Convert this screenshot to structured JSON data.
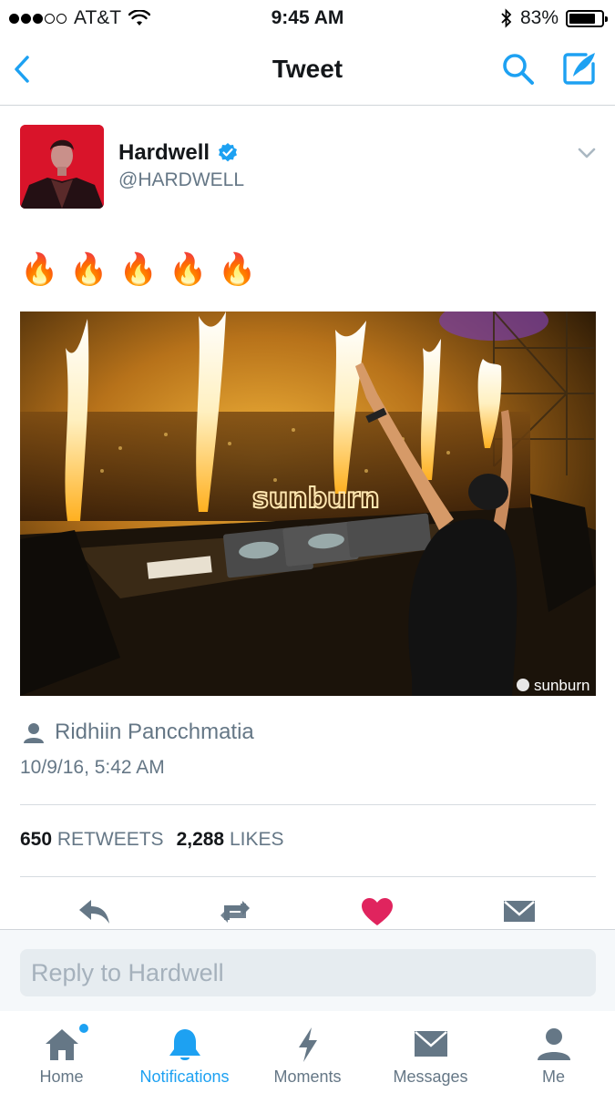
{
  "status_bar": {
    "carrier": "AT&T",
    "time": "9:45 AM",
    "battery": "83%",
    "battery_level": 0.83,
    "signal_bars": 3,
    "signal_total": 5
  },
  "nav": {
    "title": "Tweet",
    "back_icon": "chevron-left-icon",
    "search_icon": "search-icon",
    "compose_icon": "compose-icon"
  },
  "tweet": {
    "author_name": "Hardwell",
    "author_handle": "@HARDWELL",
    "verified": true,
    "text": "🔥🔥🔥🔥🔥",
    "photo_tag": "Ridhiin Pancchmatia",
    "timestamp": "10/9/16, 5:42 AM",
    "media_watermark": "sunburn",
    "media_banner": "sunburn",
    "stats": {
      "retweets_count": "650",
      "retweets_label": "RETWEETS",
      "likes_count": "2,288",
      "likes_label": "LIKES"
    },
    "actions": [
      "reply-icon",
      "retweet-icon",
      "like-icon",
      "direct-message-icon"
    ]
  },
  "reply": {
    "placeholder": "Reply to Hardwell"
  },
  "tabs": [
    {
      "label": "Home",
      "icon": "home-icon",
      "active": false,
      "badge": true
    },
    {
      "label": "Notifications",
      "icon": "bell-icon",
      "active": true,
      "badge": false
    },
    {
      "label": "Moments",
      "icon": "lightning-icon",
      "active": false,
      "badge": false
    },
    {
      "label": "Messages",
      "icon": "envelope-icon",
      "active": false,
      "badge": false
    },
    {
      "label": "Me",
      "icon": "person-icon",
      "active": false,
      "badge": false
    }
  ],
  "colors": {
    "accent": "#1da1f2",
    "text": "#14171a",
    "secondary": "#657786",
    "like": "#e0245e",
    "verified": "#1da1f2"
  }
}
